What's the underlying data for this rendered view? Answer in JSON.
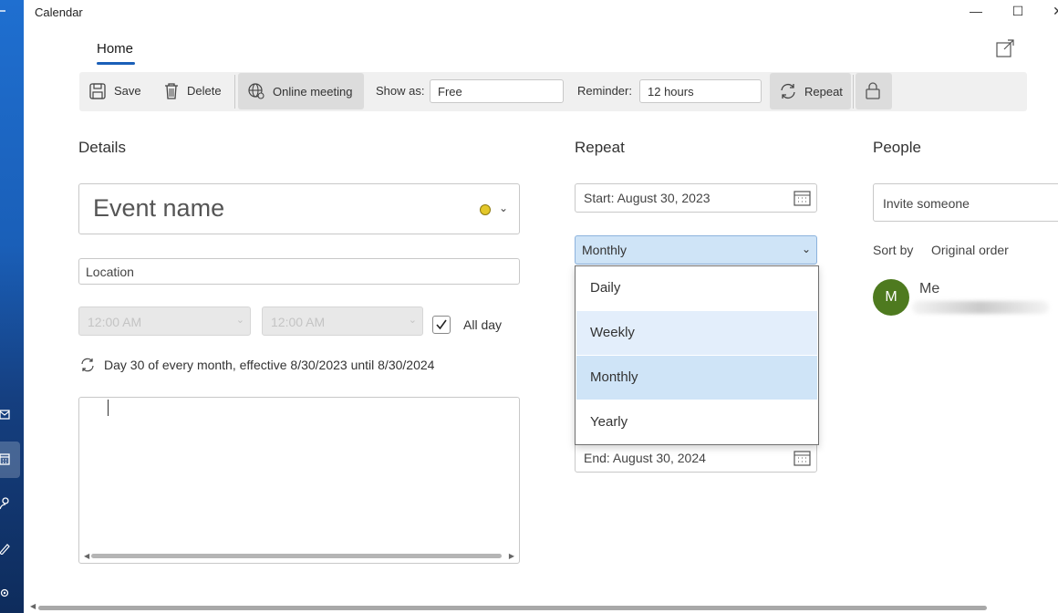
{
  "app": {
    "title": "Calendar"
  },
  "tabs": [
    {
      "label": "Home"
    }
  ],
  "toolbar": {
    "save_label": "Save",
    "delete_label": "Delete",
    "online_meeting_label": "Online meeting",
    "show_as_label": "Show as:",
    "show_as_value": "Free",
    "reminder_label": "Reminder:",
    "reminder_value": "12 hours",
    "repeat_label": "Repeat"
  },
  "details": {
    "heading": "Details",
    "event_name_placeholder": "Event name",
    "category_color": "#e3c72a",
    "location_placeholder": "Location",
    "start_time": "12:00 AM",
    "end_time": "12:00 AM",
    "all_day_label": "All day",
    "all_day_checked": true,
    "recurrence_summary": "Day 30 of every month, effective 8/30/2023 until 8/30/2024"
  },
  "repeat": {
    "heading": "Repeat",
    "start": "Start:  August 30, 2023",
    "frequency": "Monthly",
    "options": [
      "Daily",
      "Weekly",
      "Monthly",
      "Yearly"
    ],
    "end": "End:  August 30, 2024"
  },
  "people": {
    "heading": "People",
    "invite_placeholder": "Invite someone",
    "sort_by_label": "Sort by",
    "sort_by_value": "Original order",
    "attendee_initial": "M",
    "attendee_name": "Me"
  },
  "colors": {
    "accent": "#1a5fb8",
    "avatar": "#4e7a1f",
    "selected_option": "#cfe4f7"
  }
}
